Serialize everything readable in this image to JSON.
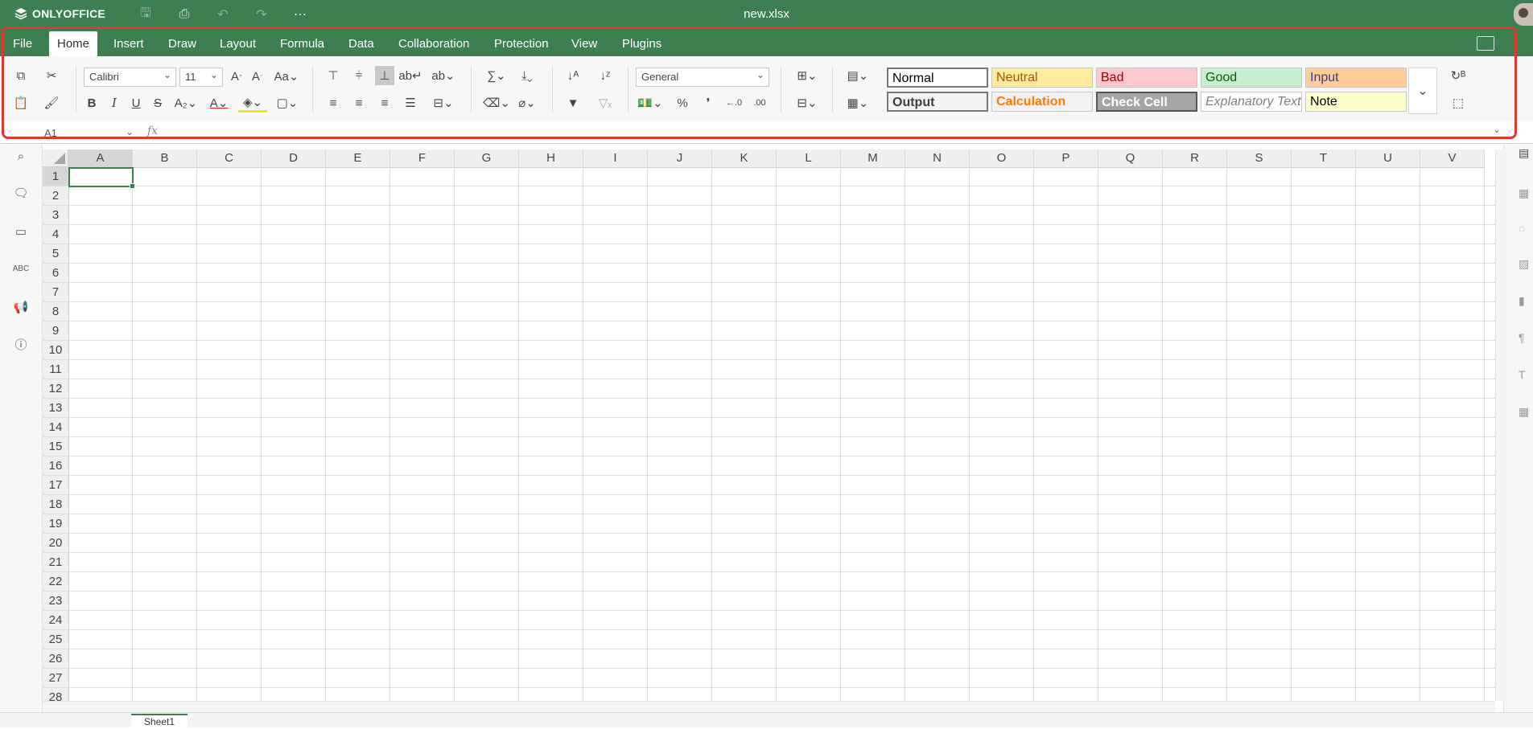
{
  "app": {
    "brand": "ONLYOFFICE",
    "doc_title": "new.xlsx"
  },
  "tabs": [
    "File",
    "Home",
    "Insert",
    "Draw",
    "Layout",
    "Formula",
    "Data",
    "Collaboration",
    "Protection",
    "View",
    "Plugins"
  ],
  "active_tab": "Home",
  "toolbar": {
    "font_name": "Calibri",
    "font_size": "11",
    "number_format": "General",
    "cell_styles": [
      {
        "label": "Normal",
        "bg": "#ffffff",
        "fg": "#000000"
      },
      {
        "label": "Neutral",
        "bg": "#ffeb9c",
        "fg": "#9c5700"
      },
      {
        "label": "Bad",
        "bg": "#ffc7ce",
        "fg": "#9c0006"
      },
      {
        "label": "Good",
        "bg": "#c6efce",
        "fg": "#006100"
      },
      {
        "label": "Input",
        "bg": "#ffcc99",
        "fg": "#3f3f76"
      },
      {
        "label": "Output",
        "bg": "#f2f2f2",
        "fg": "#3f3f3f"
      },
      {
        "label": "Calculation",
        "bg": "#f2f2f2",
        "fg": "#fa7d00"
      },
      {
        "label": "Check Cell",
        "bg": "#a5a5a5",
        "fg": "#ffffff"
      },
      {
        "label": "Explanatory Text",
        "bg": "#ffffff",
        "fg": "#7f7f7f"
      },
      {
        "label": "Note",
        "bg": "#ffffcc",
        "fg": "#000000"
      }
    ]
  },
  "formula_bar": {
    "name_box": "A1",
    "fx_label": "fx",
    "formula": ""
  },
  "grid": {
    "columns": [
      "A",
      "B",
      "C",
      "D",
      "E",
      "F",
      "G",
      "H",
      "I",
      "J",
      "K",
      "L",
      "M",
      "N",
      "O",
      "P",
      "Q",
      "R",
      "S",
      "T",
      "U",
      "V"
    ],
    "rows": [
      "1",
      "2",
      "3",
      "4",
      "5",
      "6",
      "7",
      "8",
      "9",
      "10",
      "11",
      "12",
      "13",
      "14",
      "15",
      "16",
      "17",
      "18",
      "19",
      "20",
      "21",
      "22",
      "23",
      "24",
      "25",
      "26",
      "27",
      "28"
    ],
    "selected_column": "A",
    "selected_row": "1"
  },
  "status": {
    "sheet_tab": "Sheet1"
  },
  "colors": {
    "brand_green": "#3d7f50",
    "highlight_red": "#e0392f"
  }
}
